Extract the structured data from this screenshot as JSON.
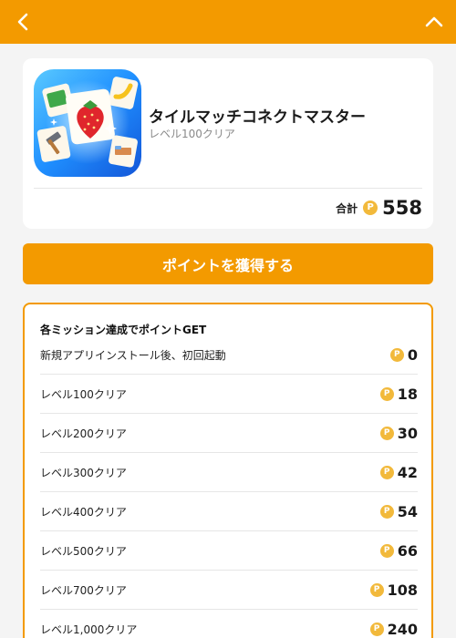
{
  "topbar": {
    "back_icon": "chevron-left-icon",
    "collapse_icon": "chevron-up-icon",
    "color": "#f39a00"
  },
  "app": {
    "title": "タイルマッチコネクトマスター",
    "subtitle": "レベル100クリア",
    "total_label": "合計",
    "total_points": "558",
    "point_icon_glyph": "P"
  },
  "cta": {
    "label": "ポイントを獲得する"
  },
  "missions": {
    "heading": "各ミッション達成でポイントGET",
    "items": [
      {
        "label": "新規アプリインストール後、初回起動",
        "points": "0"
      },
      {
        "label": "レベル100クリア",
        "points": "18"
      },
      {
        "label": "レベル200クリア",
        "points": "30"
      },
      {
        "label": "レベル300クリア",
        "points": "42"
      },
      {
        "label": "レベル400クリア",
        "points": "54"
      },
      {
        "label": "レベル500クリア",
        "points": "66"
      },
      {
        "label": "レベル700クリア",
        "points": "108"
      },
      {
        "label": "レベル1,000クリア",
        "points": "240"
      }
    ]
  },
  "colors": {
    "accent": "#f39a00",
    "coin": "#f2b93b",
    "background": "#f4f4f4"
  }
}
